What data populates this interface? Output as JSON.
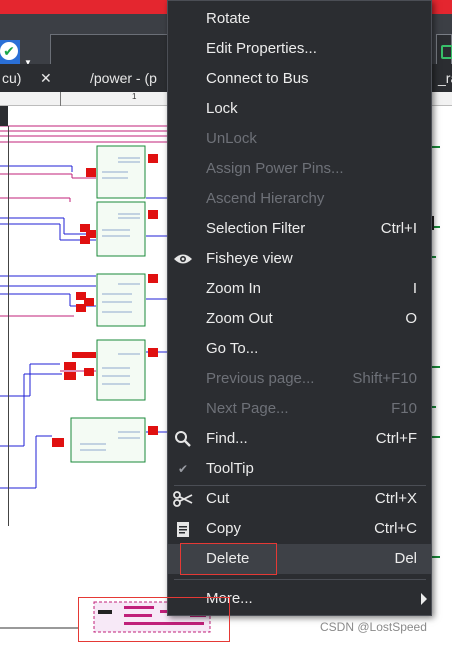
{
  "toolbar": {
    "check_icon": "check-circle-icon",
    "dropdown_glyph": "▼"
  },
  "tabs": [
    {
      "label": "cu)"
    },
    {
      "label": "/power - (p"
    },
    {
      "label": "_ra"
    }
  ],
  "tab_close_glyph": "✕",
  "ruler": {
    "label": "1"
  },
  "context_menu": {
    "items": [
      {
        "label": "Rotate",
        "shortcut": "",
        "enabled": true
      },
      {
        "label": "Edit Properties...",
        "shortcut": "",
        "enabled": true
      },
      {
        "label": "Connect to Bus",
        "shortcut": "",
        "enabled": true
      },
      {
        "label": "Lock",
        "shortcut": "",
        "enabled": true
      },
      {
        "label": "UnLock",
        "shortcut": "",
        "enabled": false
      },
      {
        "label": "Assign Power Pins...",
        "shortcut": "",
        "enabled": false
      },
      {
        "label": "Ascend Hierarchy",
        "shortcut": "",
        "enabled": false
      },
      {
        "label": "Selection Filter",
        "shortcut": "Ctrl+I",
        "enabled": true
      },
      {
        "label": "Fisheye view",
        "shortcut": "",
        "enabled": true,
        "icon": "eye-icon"
      },
      {
        "label": "Zoom In",
        "shortcut": "I",
        "enabled": true
      },
      {
        "label": "Zoom Out",
        "shortcut": "O",
        "enabled": true
      },
      {
        "label": "Go To...",
        "shortcut": "",
        "enabled": true
      },
      {
        "label": "Previous page...",
        "shortcut": "Shift+F10",
        "enabled": false
      },
      {
        "label": "Next Page...",
        "shortcut": "F10",
        "enabled": false
      },
      {
        "label": "Find...",
        "shortcut": "Ctrl+F",
        "enabled": true,
        "icon": "search-icon"
      },
      {
        "label": "ToolTip",
        "shortcut": "",
        "enabled": true,
        "icon": "checkmark-icon"
      },
      {
        "label": "Cut",
        "shortcut": "Ctrl+X",
        "enabled": true,
        "icon": "scissors-icon"
      },
      {
        "label": "Copy",
        "shortcut": "Ctrl+C",
        "enabled": true,
        "icon": "copy-icon"
      },
      {
        "label": "Delete",
        "shortcut": "Del",
        "enabled": true,
        "highlighted": true
      },
      {
        "label": "More...",
        "shortcut": "",
        "enabled": true,
        "submenu": true
      }
    ]
  },
  "watermark": "CSDN @LostSpeed",
  "colors": {
    "accent_red": "#e4262f",
    "menu_bg": "#2b2d31",
    "wire_blue": "#1f1fd6",
    "wire_magenta": "#c0207a",
    "part_green": "#1a8a3a",
    "pin_red": "#e01010"
  }
}
